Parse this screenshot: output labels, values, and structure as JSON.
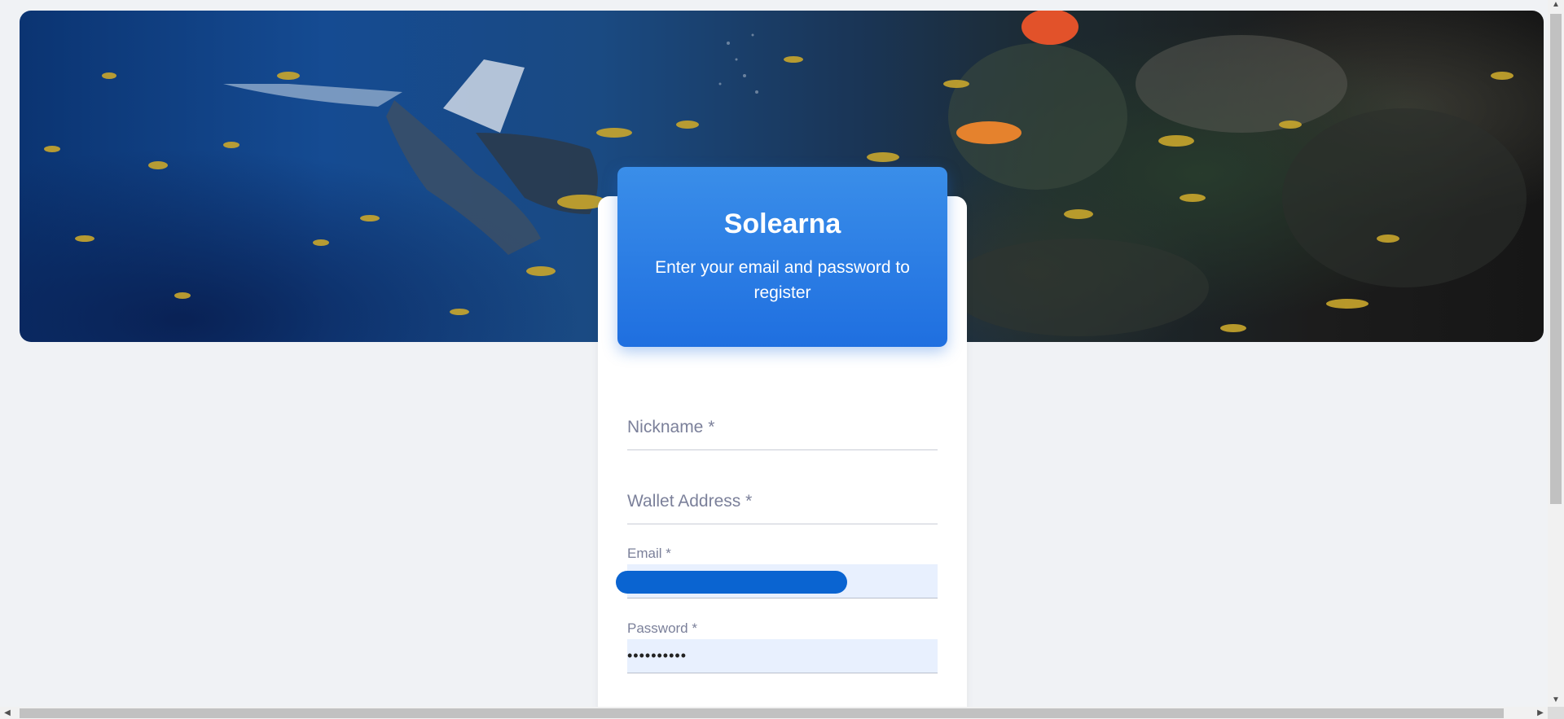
{
  "app": {
    "title": "Solearna",
    "subtitle": "Enter your email and password to register"
  },
  "hero": {
    "image": "underwater-diver-reef-image"
  },
  "form": {
    "nickname": {
      "label": "Nickname *",
      "value": ""
    },
    "wallet": {
      "label": "Wallet Address *",
      "value": ""
    },
    "email": {
      "label": "Email *",
      "value": "(redacted)"
    },
    "password": {
      "label": "Password *",
      "value": "••••••••••"
    }
  },
  "colors": {
    "accent": "#1f6fe0",
    "background": "#f0f2f5",
    "autofill": "#e8f0fe"
  }
}
